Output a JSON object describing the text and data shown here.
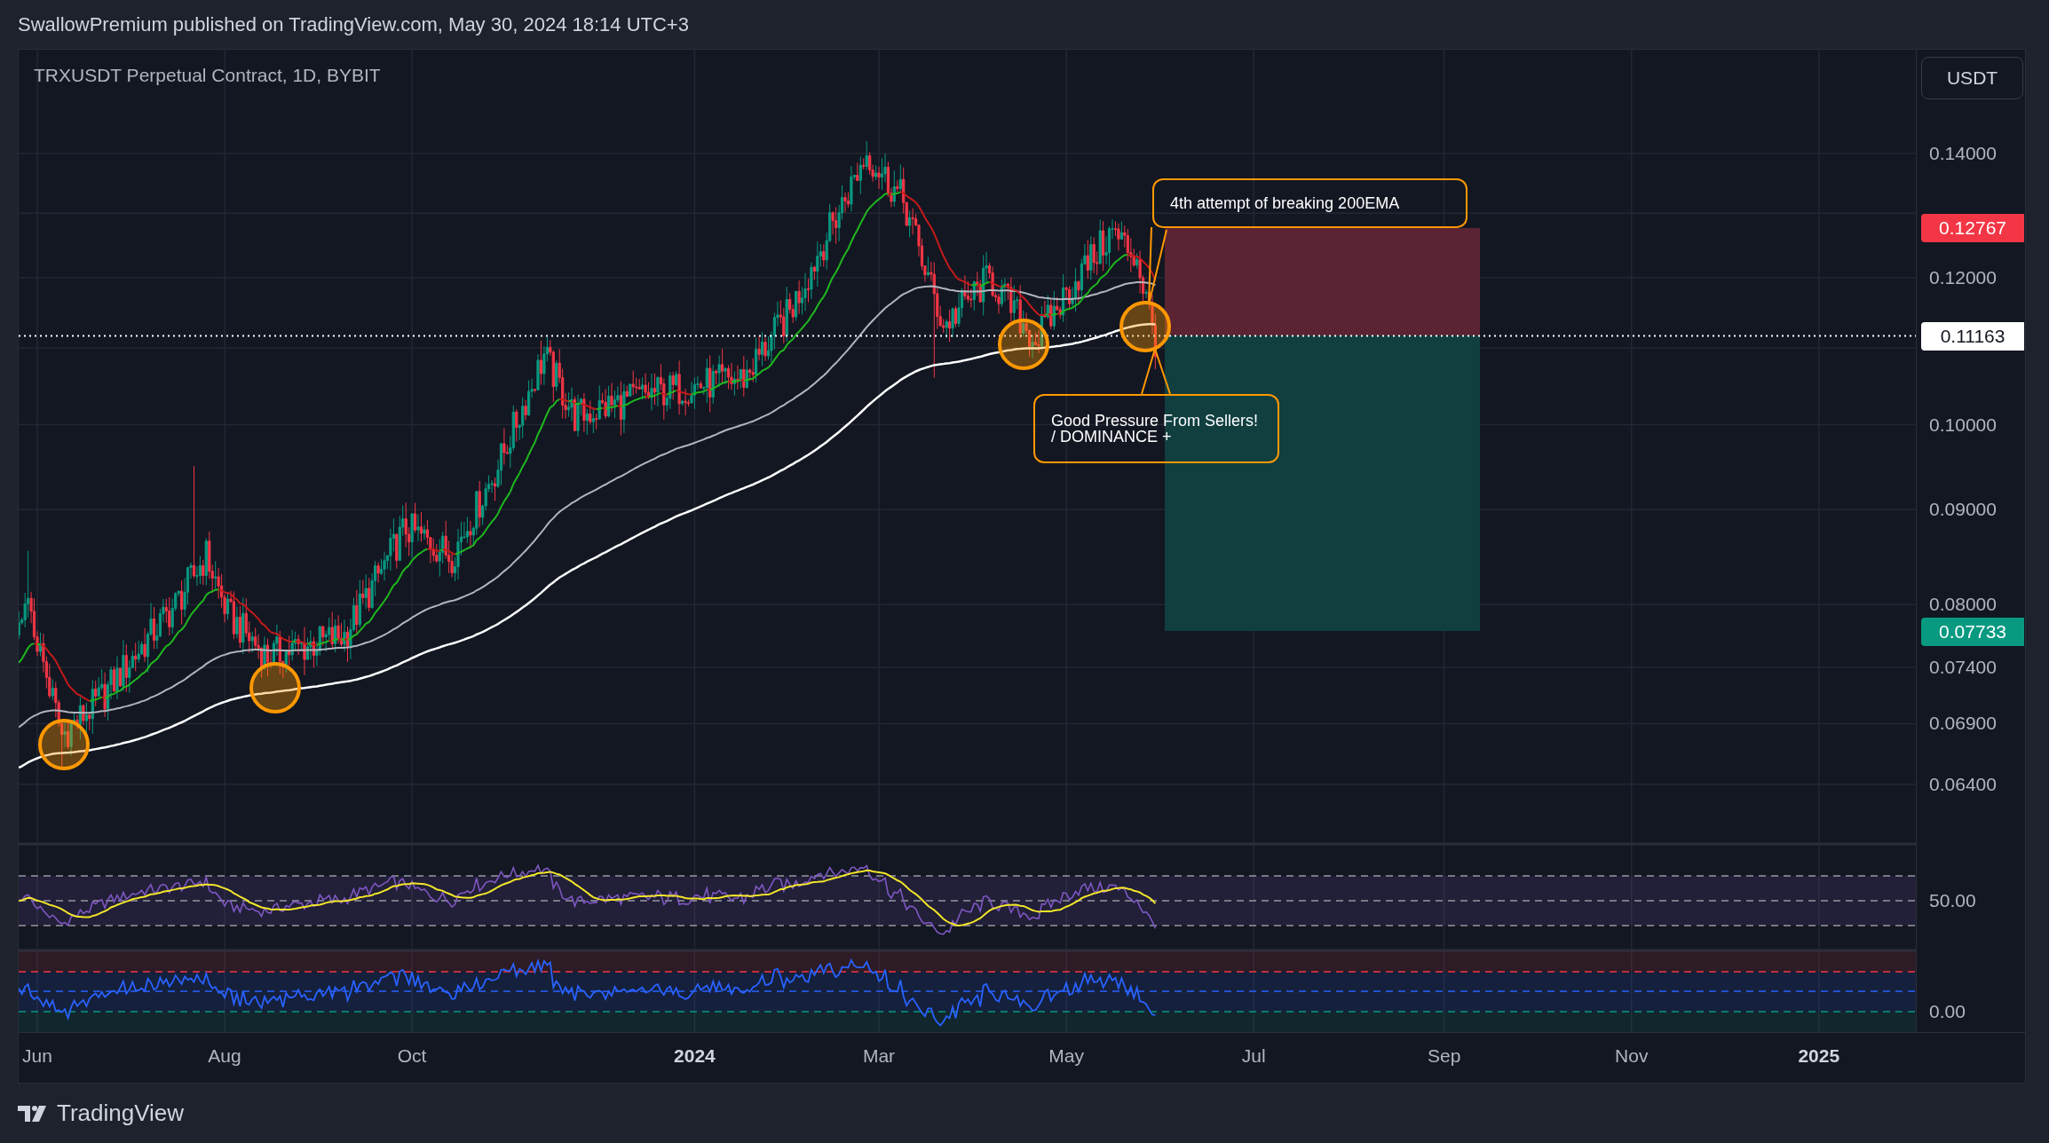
{
  "header": {
    "text": "SwallowPremium published on TradingView.com, May 30, 2024 18:14 UTC+3"
  },
  "chart": {
    "legend": "TRXUSDT Perpetual Contract, 1D, BYBIT",
    "currency_button": "USDT",
    "price_axis": [
      "0.14000",
      "0.12000",
      "0.10000",
      "0.09000",
      "0.08000",
      "0.07400",
      "0.06900",
      "0.06400"
    ],
    "price_tags": [
      {
        "text": "0.12767",
        "color": "#f23645"
      },
      {
        "text": "0.11163",
        "color": "#ffffff"
      },
      {
        "text": "0.07733",
        "color": "#089981"
      }
    ],
    "annotations": [
      {
        "text": "4th attempt of breaking 200EMA"
      },
      {
        "text": "Good Pressure From Sellers! / DOMINANCE +"
      }
    ],
    "rsi_axis": "50.00",
    "oscillator_axis": "0.00",
    "time_axis": [
      {
        "label": "Jun",
        "kind": "month"
      },
      {
        "label": "Aug",
        "kind": "month"
      },
      {
        "label": "Oct",
        "kind": "month"
      },
      {
        "label": "2024",
        "kind": "year"
      },
      {
        "label": "Mar",
        "kind": "month"
      },
      {
        "label": "May",
        "kind": "month"
      },
      {
        "label": "Jul",
        "kind": "month"
      },
      {
        "label": "Sep",
        "kind": "month"
      },
      {
        "label": "Nov",
        "kind": "month"
      },
      {
        "label": "2025",
        "kind": "year"
      }
    ]
  },
  "footer": {
    "brand": "TradingView"
  }
}
